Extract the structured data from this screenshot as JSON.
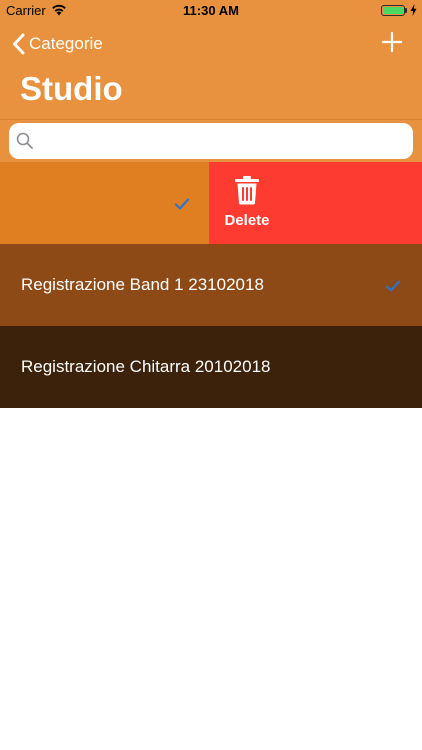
{
  "status_bar": {
    "carrier": "Carrier",
    "time": "11:30 AM",
    "wifi_icon": "wifi-icon",
    "battery_icon": "battery-icon",
    "battery_level": 1.0
  },
  "nav": {
    "back_label": "Categorie",
    "back_icon": "chevron-left-icon",
    "add_icon": "plus-icon"
  },
  "page": {
    "title": "Studio"
  },
  "search": {
    "value": "",
    "placeholder": "",
    "icon": "search-icon"
  },
  "rows": [
    {
      "label": "",
      "checked": true,
      "color": "#e07f22"
    },
    {
      "label": "Registrazione Band 1 23102018",
      "checked": true,
      "color": "#8e4a16"
    },
    {
      "label": "Registrazione Chitarra 20102018",
      "checked": false,
      "color": "#3c220b"
    }
  ],
  "swipe_action": {
    "label": "Delete",
    "icon": "trash-icon",
    "color": "#fe3b30"
  },
  "colors": {
    "header": "#e8923f",
    "checkmark": "#2e73cc"
  }
}
